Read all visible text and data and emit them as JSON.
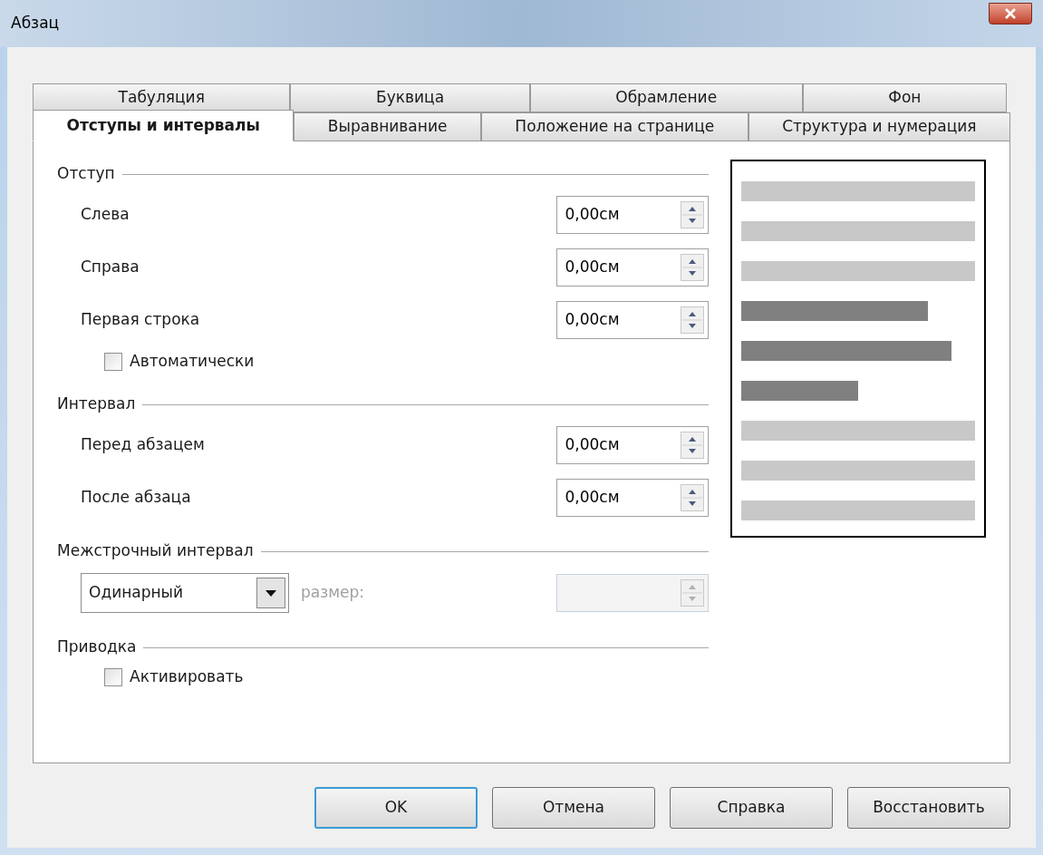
{
  "window": {
    "title": "Абзац"
  },
  "tab_rows": [
    [
      {
        "label": "Табуляция",
        "selected": false
      },
      {
        "label": "Буквица",
        "selected": false
      },
      {
        "label": "Обрамление",
        "selected": false
      },
      {
        "label": "Фон",
        "selected": false
      }
    ],
    [
      {
        "label": "Отступы и интервалы",
        "selected": true
      },
      {
        "label": "Выравнивание",
        "selected": false
      },
      {
        "label": "Положение на странице",
        "selected": false
      },
      {
        "label": "Структура и нумерация",
        "selected": false
      }
    ]
  ],
  "sections": [
    {
      "title": "Отступ",
      "items": [
        {
          "kind": "spin",
          "label": "Слева",
          "value": "0,00см",
          "disabled": false
        },
        {
          "kind": "spin",
          "label": "Справа",
          "value": "0,00см",
          "disabled": false
        },
        {
          "kind": "spin",
          "label": "Первая строка",
          "value": "0,00см",
          "disabled": false
        },
        {
          "kind": "checkbox",
          "label": "Автоматически",
          "checked": false
        }
      ]
    },
    {
      "title": "Интервал",
      "items": [
        {
          "kind": "spin",
          "label": "Перед абзацем",
          "value": "0,00см",
          "disabled": false
        },
        {
          "kind": "spin",
          "label": "После абзаца",
          "value": "0,00см",
          "disabled": false
        }
      ]
    },
    {
      "title": "Межстрочный интервал",
      "items": [
        {
          "kind": "select",
          "value": "Одинарный",
          "size_label": "размер:",
          "size_disabled": true
        }
      ]
    },
    {
      "title": "Приводка",
      "items": [
        {
          "kind": "checkbox",
          "label": "Активировать",
          "checked": false
        }
      ]
    }
  ],
  "buttons": [
    {
      "label": "OK",
      "default": true
    },
    {
      "label": "Отмена",
      "default": false
    },
    {
      "label": "Справка",
      "default": false
    },
    {
      "label": "Восстановить",
      "default": false
    }
  ]
}
